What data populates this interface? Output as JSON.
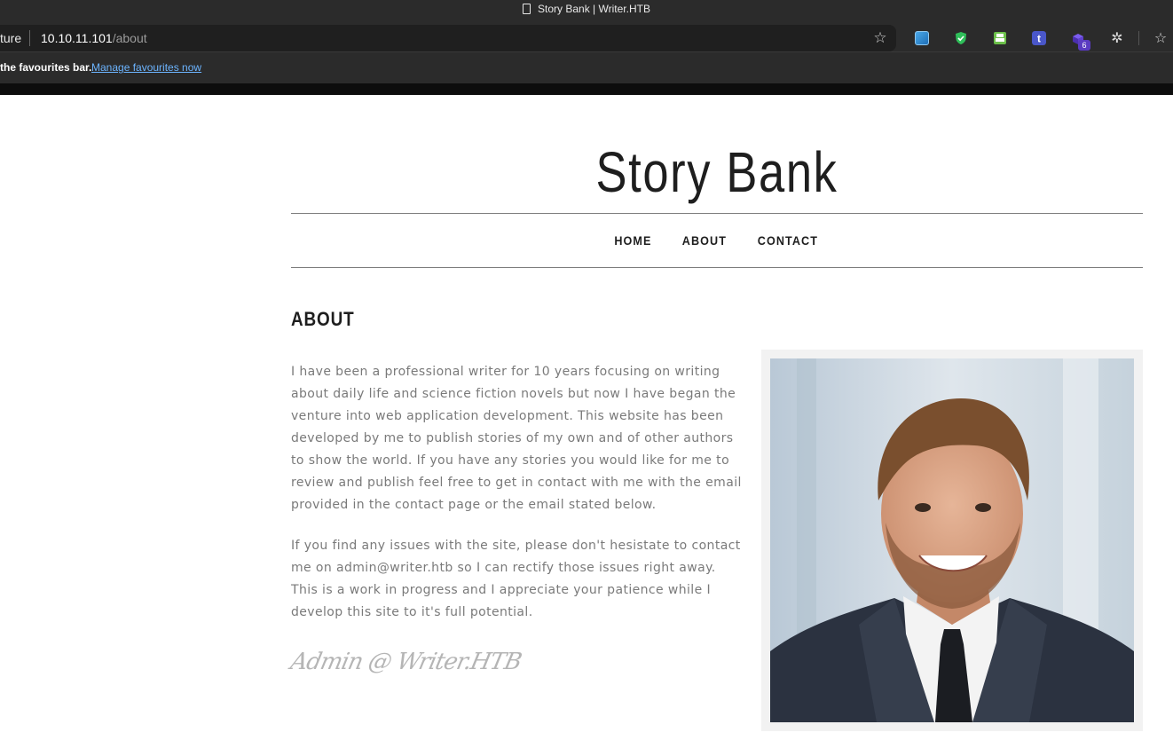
{
  "browser": {
    "tab_title": "Story Bank | Writer.HTB",
    "address_prefix": "ture",
    "url_host": "10.10.11.101",
    "url_path": "/about",
    "favbar_message": "the favourites bar.",
    "favbar_link": "Manage favourites now",
    "extension_badge": "6",
    "icons": [
      "page-icon",
      "favourite-add-icon",
      "extension-icons",
      "puzzle-extensions-icon",
      "favourites-list-icon"
    ]
  },
  "site": {
    "title": "Story Bank",
    "nav": [
      "HOME",
      "ABOUT",
      "CONTACT"
    ],
    "section_heading": "ABOUT",
    "paragraphs": [
      "I have been a professional writer for 10 years focusing on writing about daily life and science fiction novels but now I have began the venture into web application development. This website has been developed by me to publish stories of my own and of other authors to show the world. If you have any stories you would like for me to review and publish feel free to get in contact with me with the email provided in the contact page or the email stated below.",
      "If you find any issues with the site, please don't hesistate to contact me on admin@writer.htb so I can rectify those issues right away. This is a work in progress and I appreciate your patience while I develop this site to it's full potential."
    ],
    "signature": "Admin @ Writer.HTB",
    "photo_alt": "portrait"
  }
}
